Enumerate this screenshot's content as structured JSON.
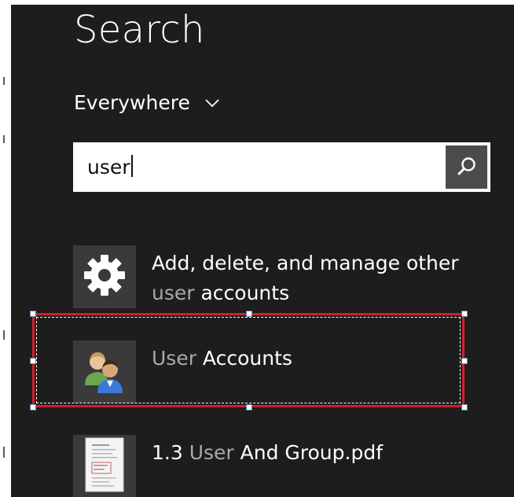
{
  "panel": {
    "title": "Search",
    "scope_label": "Everywhere",
    "scope_icon": "chevron-down-icon"
  },
  "search": {
    "value": "user",
    "button_icon": "search-icon"
  },
  "results": [
    {
      "icon": "gear-icon",
      "line1": "Add, delete, and manage other",
      "line2_highlight": "user",
      "line2_rest": " accounts"
    },
    {
      "icon": "user-accounts-icon",
      "highlight": "User",
      "rest": " Accounts"
    },
    {
      "icon": "pdf-document-icon",
      "prefix": "1.3 ",
      "highlight": "User",
      "rest": " And Group.pdf"
    }
  ],
  "colors": {
    "pane_background": "#1d1d1d",
    "tile_background": "#3a3a3a",
    "match_highlight": "#a9a9a9",
    "selection_border": "#d21f2c"
  }
}
